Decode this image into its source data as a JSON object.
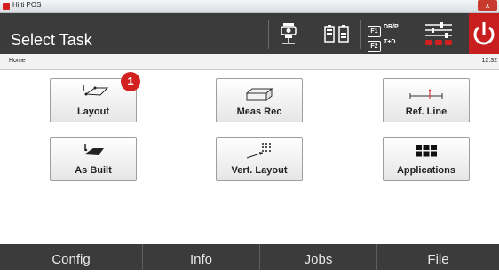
{
  "window": {
    "title": "Hilti POS",
    "close_label": "x"
  },
  "header": {
    "title": "Select Task",
    "f1_key": "F1",
    "f1_label": "DR/P",
    "f2_key": "F2",
    "f2_label": "T+D"
  },
  "breadcrumb": {
    "home": "Home",
    "time": "12:32"
  },
  "tiles": {
    "layout": "Layout",
    "meas_rec": "Meas Rec",
    "ref_line": "Ref. Line",
    "as_built": "As Built",
    "vert_layout": "Vert. Layout",
    "applications": "Applications"
  },
  "callout": {
    "number": "1"
  },
  "footer": {
    "config": "Config",
    "info": "Info",
    "jobs": "Jobs",
    "file": "File"
  },
  "colors": {
    "header_bg": "#3b3b3b",
    "accent_red": "#d21f1f",
    "tile_border": "#9e9e9e"
  }
}
